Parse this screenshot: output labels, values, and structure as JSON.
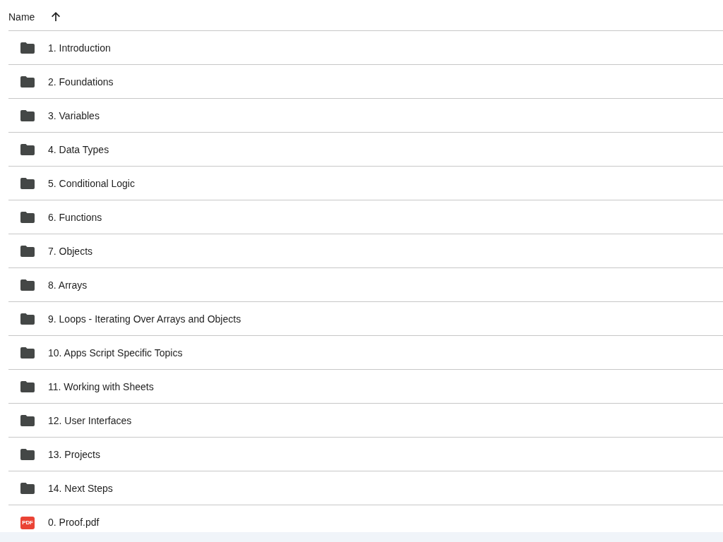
{
  "header": {
    "column": "Name",
    "sorted_ascending": true
  },
  "files": [
    {
      "name": "1. Introduction",
      "kind": "folder"
    },
    {
      "name": "2. Foundations",
      "kind": "folder"
    },
    {
      "name": "3. Variables",
      "kind": "folder"
    },
    {
      "name": "4. Data Types",
      "kind": "folder"
    },
    {
      "name": "5. Conditional Logic",
      "kind": "folder"
    },
    {
      "name": "6. Functions",
      "kind": "folder"
    },
    {
      "name": "7. Objects",
      "kind": "folder"
    },
    {
      "name": "8. Arrays",
      "kind": "folder"
    },
    {
      "name": "9. Loops - Iterating Over Arrays and Objects",
      "kind": "folder"
    },
    {
      "name": "10. Apps Script Specific Topics",
      "kind": "folder"
    },
    {
      "name": "11. Working with Sheets",
      "kind": "folder"
    },
    {
      "name": "12. User Interfaces",
      "kind": "folder"
    },
    {
      "name": "13. Projects",
      "kind": "folder"
    },
    {
      "name": "14. Next Steps",
      "kind": "folder"
    },
    {
      "name": "0. Proof.pdf",
      "kind": "pdf",
      "badge": "PDF"
    }
  ]
}
